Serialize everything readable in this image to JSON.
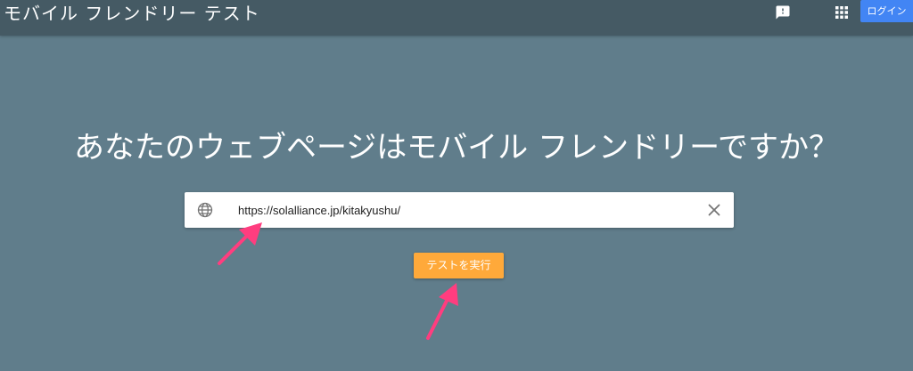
{
  "header": {
    "title": "モバイル フレンドリー テスト",
    "feedback_icon": "feedback-icon",
    "apps_icon": "apps-grid-icon",
    "login_label": "ログイン"
  },
  "main": {
    "headline": "あなたのウェブページはモバイル フレンドリーですか？",
    "url_input": {
      "value": "https://solalliance.jp/kitakyushu/",
      "icon": "globe-icon",
      "clear_icon": "close-icon"
    },
    "run_button_label": "テストを実行"
  },
  "colors": {
    "page_background": "#607d8b",
    "header_background": "#455a64",
    "login_button": "#4285f4",
    "run_button": "#ffa93a",
    "annotation_arrow": "#ff3d7f"
  }
}
